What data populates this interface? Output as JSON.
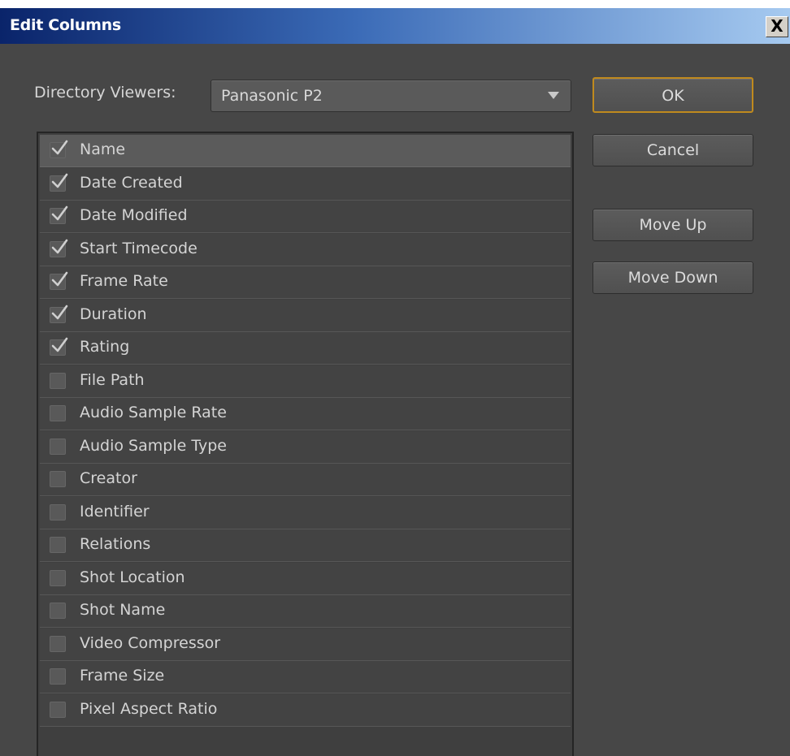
{
  "dialog": {
    "title": "Edit Columns",
    "close_label": "X"
  },
  "directory_viewers": {
    "label": "Directory Viewers:",
    "selected": "Panasonic P2"
  },
  "buttons": {
    "ok": "OK",
    "cancel": "Cancel",
    "move_up": "Move Up",
    "move_down": "Move Down"
  },
  "columns": [
    {
      "label": "Name",
      "checked": true,
      "selected": true
    },
    {
      "label": "Date Created",
      "checked": true
    },
    {
      "label": "Date Modified",
      "checked": true
    },
    {
      "label": "Start Timecode",
      "checked": true
    },
    {
      "label": "Frame Rate",
      "checked": true
    },
    {
      "label": "Duration",
      "checked": true
    },
    {
      "label": "Rating",
      "checked": true
    },
    {
      "label": "File Path",
      "checked": false
    },
    {
      "label": "Audio Sample Rate",
      "checked": false
    },
    {
      "label": "Audio Sample Type",
      "checked": false
    },
    {
      "label": "Creator",
      "checked": false
    },
    {
      "label": "Identifier",
      "checked": false
    },
    {
      "label": "Relations",
      "checked": false
    },
    {
      "label": "Shot Location",
      "checked": false
    },
    {
      "label": "Shot Name",
      "checked": false
    },
    {
      "label": "Video Compressor",
      "checked": false
    },
    {
      "label": "Frame Size",
      "checked": false
    },
    {
      "label": "Pixel Aspect Ratio",
      "checked": false
    }
  ],
  "colors": {
    "dialog_bg": "#474747",
    "title_gradient_start": "#0a246a",
    "title_gradient_end": "#a6caf0",
    "ok_focus_border": "#c08a1e"
  },
  "icons": {
    "close": "close-icon",
    "dropdown": "chevron-down-icon",
    "check": "checkmark-icon"
  }
}
